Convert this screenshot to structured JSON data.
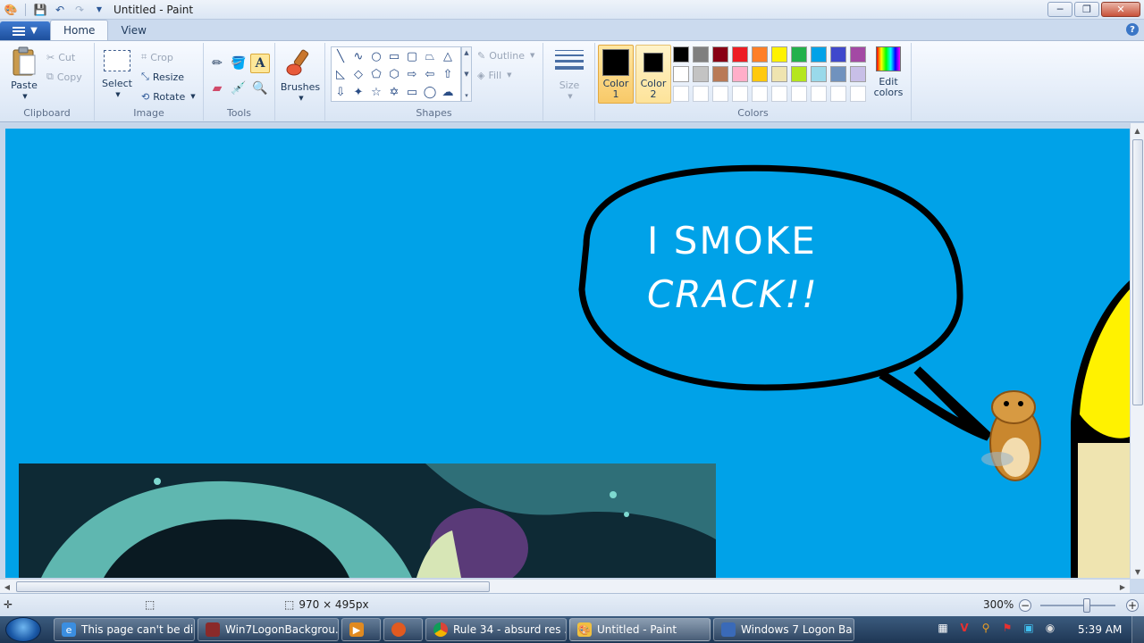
{
  "window": {
    "title": "Untitled - Paint",
    "minimize": "─",
    "maximize": "❐",
    "close": "✕"
  },
  "tabs": [
    {
      "label": "Home",
      "active": true
    },
    {
      "label": "View",
      "active": false
    }
  ],
  "help": "?",
  "ribbon": {
    "clipboard": {
      "label": "Clipboard",
      "paste": "Paste",
      "cut": "Cut",
      "copy": "Copy"
    },
    "image": {
      "label": "Image",
      "select": "Select",
      "crop": "Crop",
      "resize": "Resize",
      "rotate": "Rotate"
    },
    "tools": {
      "label": "Tools"
    },
    "brushes": {
      "label": "Brushes"
    },
    "shapes": {
      "label": "Shapes",
      "outline": "Outline",
      "fill": "Fill"
    },
    "size": {
      "label": "Size"
    },
    "colors": {
      "label": "Colors",
      "color1_label_a": "Color",
      "color1_label_b": "1",
      "color2_label_a": "Color",
      "color2_label_b": "2",
      "color1": "#000000",
      "color2": "#000000",
      "edit_a": "Edit",
      "edit_b": "colors",
      "palette_row1": [
        "#000000",
        "#7f7f7f",
        "#880015",
        "#ed1c24",
        "#ff7f27",
        "#fff200",
        "#22b14c",
        "#00a2e8",
        "#3f48cc",
        "#a349a4"
      ],
      "palette_row2": [
        "#ffffff",
        "#c3c3c3",
        "#b97a57",
        "#ffaec9",
        "#ffc90e",
        "#efe4b0",
        "#b5e61d",
        "#99d9ea",
        "#7092be",
        "#c8bfe7"
      ],
      "palette_row3": [
        "#ffffff",
        "#ffffff",
        "#ffffff",
        "#ffffff",
        "#ffffff",
        "#ffffff",
        "#ffffff",
        "#ffffff",
        "#ffffff",
        "#ffffff"
      ]
    }
  },
  "canvas": {
    "background": "#00a2e8",
    "speech_line1": "I SMOKE",
    "speech_line2": "CRACK!!"
  },
  "status": {
    "dimensions": "970 × 495px",
    "zoom": "300%",
    "zoom_out": "−",
    "zoom_in": "+"
  },
  "taskbar": {
    "tasks": [
      {
        "label": "This page can't be di...",
        "icon": "ie-icon"
      },
      {
        "label": "Win7LogonBackgrou...",
        "icon": "app-icon"
      },
      {
        "label": "",
        "icon": "media-icon"
      },
      {
        "label": "",
        "icon": "firefox-icon"
      },
      {
        "label": "Rule 34 - absurd res ...",
        "icon": "chrome-icon"
      },
      {
        "label": "Untitled - Paint",
        "icon": "paint-icon"
      },
      {
        "label": "Windows 7 Logon Ba...",
        "icon": "window-icon"
      }
    ],
    "clock": "5:39 AM"
  }
}
